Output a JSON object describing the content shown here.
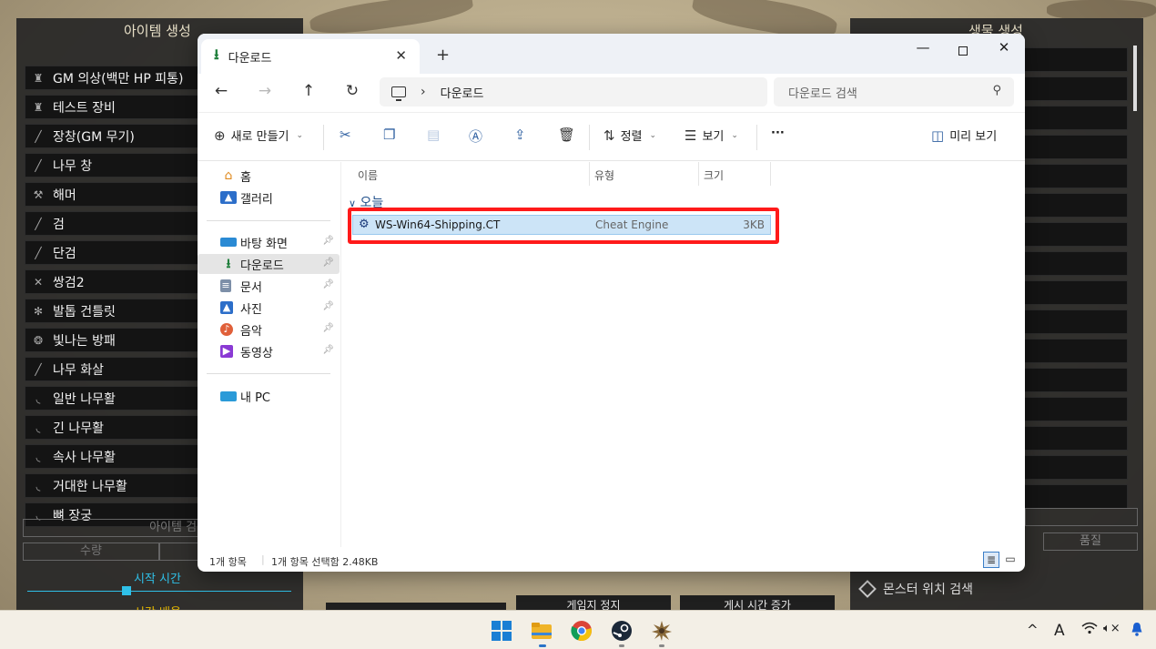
{
  "game": {
    "left_title": "아이템 생성",
    "items": [
      {
        "label": "GM 의상(백만 HP 피통)",
        "icon": "armor-icon"
      },
      {
        "label": "테스트 장비",
        "icon": "armor-icon"
      },
      {
        "label": "장창(GM 무기)",
        "icon": "spear-icon"
      },
      {
        "label": "나무 창",
        "icon": "spear-icon"
      },
      {
        "label": "해머",
        "icon": "hammer-icon"
      },
      {
        "label": "검",
        "icon": "sword-icon"
      },
      {
        "label": "단검",
        "icon": "dagger-icon"
      },
      {
        "label": "쌍검2",
        "icon": "dual-sword-icon"
      },
      {
        "label": "발톱 건틀릿",
        "icon": "claw-icon"
      },
      {
        "label": "빛나는 방패",
        "icon": "shield-icon"
      },
      {
        "label": "나무 화살",
        "icon": "arrow-icon"
      },
      {
        "label": "일반 나무활",
        "icon": "bow-icon"
      },
      {
        "label": "긴 나무활",
        "icon": "bow-icon"
      },
      {
        "label": "속사 나무활",
        "icon": "bow-icon"
      },
      {
        "label": "거대한 나무활",
        "icon": "bow-icon"
      },
      {
        "label": "뼈 장궁",
        "icon": "bow-icon"
      }
    ],
    "item_search": "아이템 검색",
    "quantity": "수량",
    "start_time": "시작 시간",
    "time_rate": "시간 배율",
    "right_title": "생물 생성",
    "quality": "품질",
    "monster_search": "몬스터 위치 검색",
    "bottom_btn_1": "게임지 정지",
    "bottom_btn_2": "게시 시간 증가"
  },
  "explorer": {
    "tab_title": "다운로드",
    "address": "다운로드",
    "search_placeholder": "다운로드 검색",
    "toolbar": {
      "new": "새로 만들기",
      "sort": "정렬",
      "view": "보기",
      "more": "···",
      "preview": "미리 보기"
    },
    "nav": {
      "home": "홈",
      "gallery": "갤러리",
      "desktop": "바탕 화면",
      "downloads": "다운로드",
      "documents": "문서",
      "pictures": "사진",
      "music": "음악",
      "videos": "동영상",
      "this_pc": "내 PC"
    },
    "columns": {
      "name": "이름",
      "type": "유형",
      "size": "크기"
    },
    "group": "오늘",
    "file": {
      "name": "WS-Win64-Shipping.CT",
      "type": "Cheat Engine",
      "size": "3KB"
    },
    "status": {
      "count": "1개 항목",
      "selected": "1개 항목 선택함 2.48KB"
    }
  },
  "taskbar": {
    "tray_caret": "^",
    "tray_ime": "A"
  },
  "colors": {
    "highlight": "#ff1a1a",
    "selection": "#cce4f7",
    "accent": "#2fc0e8"
  }
}
